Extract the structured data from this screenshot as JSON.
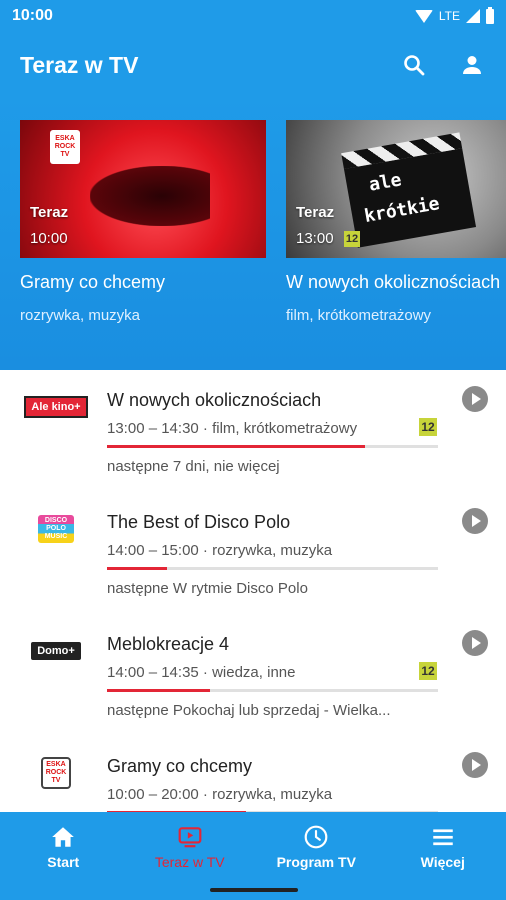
{
  "status_bar": {
    "time": "10:00",
    "network": "LTE"
  },
  "app_bar": {
    "title": "Teraz w TV",
    "actions": [
      "search-icon",
      "account-icon"
    ]
  },
  "hero": {
    "cards": [
      {
        "label": "Teraz",
        "time": "10:00",
        "title": "Gramy co chcemy",
        "genres": "rozrywka, muzyka",
        "channel_logo": "ESKA ROCK TV"
      },
      {
        "label": "Teraz",
        "time": "13:00",
        "age": "12",
        "title": "W nowych okolicznościach",
        "genres": "film, krótkometrażowy",
        "clapper_text": [
          "ale",
          "krótkie"
        ]
      }
    ]
  },
  "list": [
    {
      "channel_logo": "Ale kino+",
      "title": "W nowych okolicznościach",
      "meta": "13:00 – 14:30 · film, krótkometrażowy",
      "age": "12",
      "progress": 0.78,
      "next": "następne 7 dni, nie więcej"
    },
    {
      "channel_logo": "DISCO POLO MUSIC",
      "title": "The Best of Disco Polo",
      "meta": "14:00 – 15:00 · rozrywka, muzyka",
      "age": "",
      "progress": 0.18,
      "next": "następne W rytmie Disco Polo"
    },
    {
      "channel_logo": "Domo+",
      "title": "Meblokreacje 4",
      "meta": "14:00 – 14:35 · wiedza, inne",
      "age": "12",
      "progress": 0.31,
      "next": "następne Pokochaj lub sprzedaj - Wielka..."
    },
    {
      "channel_logo": "ESKA ROCK TV",
      "title": "Gramy co chcemy",
      "meta": "10:00 – 20:00 · rozrywka, muzyka",
      "age": "",
      "progress": 0.42,
      "next": ""
    }
  ],
  "bottom_nav": [
    {
      "label": "Start",
      "icon": "home-icon",
      "active": false
    },
    {
      "label": "Teraz w TV",
      "icon": "tv-play-icon",
      "active": true
    },
    {
      "label": "Program TV",
      "icon": "clock-icon",
      "active": false
    },
    {
      "label": "Więcej",
      "icon": "menu-icon",
      "active": false
    }
  ],
  "colors": {
    "primary": "#1f9be8",
    "accent": "#e32636",
    "age_badge": "#c7d43a"
  }
}
